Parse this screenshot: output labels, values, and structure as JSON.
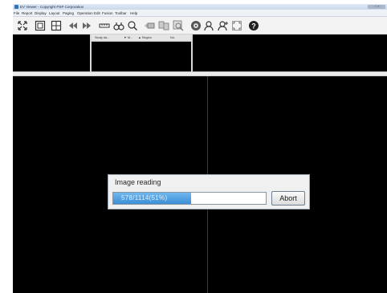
{
  "window": {
    "title": "EV Viewer - Copyright PSP Corporation",
    "controls_label": "- □ ×"
  },
  "menu": [
    "File",
    "Report",
    "Display",
    "Layout",
    "Paging",
    "Operation",
    "Edit",
    "Fusion",
    "Toolbar",
    "Help"
  ],
  "toolbar": {
    "icons": [
      "expand-arrows-icon",
      "grid-layout-icon",
      "split-layout-icon",
      "rewind-icon",
      "fast-forward-icon",
      "ruler-icon",
      "binoculars-icon",
      "magnifier-icon",
      "camera-link-icon",
      "sync-images-icon",
      "zoom-image-icon",
      "disc-icon",
      "users-icon",
      "users-add-icon",
      "fullscreen-icon",
      "help-icon"
    ]
  },
  "series_list": {
    "columns": [
      "Study da...",
      "▼ M...",
      "▲ Region",
      "No."
    ]
  },
  "dialog": {
    "title": "Image reading",
    "progress_text": "578/1114(51%)",
    "progress_percent": 51,
    "abort_label": "Abort"
  }
}
